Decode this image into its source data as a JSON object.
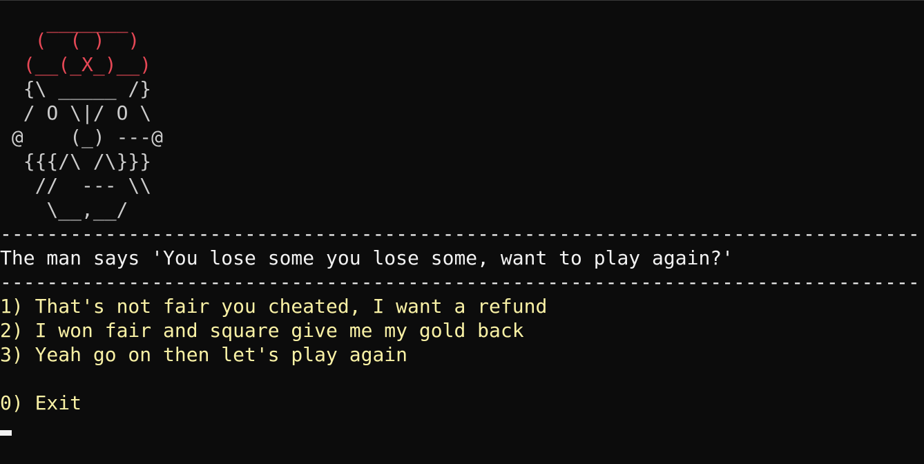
{
  "art": {
    "red_lines": [
      "    _______",
      "   (  ( )  )",
      "  (__(_X_)__)"
    ],
    "white_lines": [
      "  {\\ _____ /}",
      "  / O \\|/ O \\",
      " @    (_) ---@",
      "  {{{/\\ /\\}}}",
      "   //  --- \\\\",
      "    \\__,__/"
    ]
  },
  "separator": "-------------------------------------------------------------------------------",
  "message": "The man says 'You lose some you lose some, want to play again?'",
  "options": [
    "1) That's not fair you cheated, I want a refund",
    "2) I won fair and square give me my gold back",
    "3) Yeah go on then let's play again"
  ],
  "exit_option": "0) Exit",
  "colors": {
    "background": "#0c0c0c",
    "art_red": "#e74856",
    "art_white": "#cccccc",
    "message": "#f2f2f2",
    "options": "#f9f1a5"
  }
}
